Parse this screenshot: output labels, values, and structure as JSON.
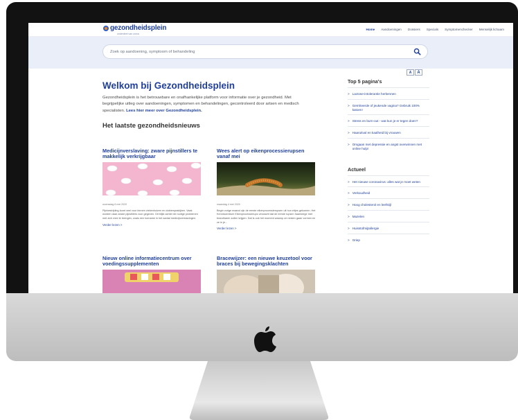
{
  "site": {
    "logo_name": "gezondheidsplein",
    "logo_tagline": "onderdeel van zorva",
    "nav": [
      {
        "label": "Home",
        "active": true
      },
      {
        "label": "Aandoeningen"
      },
      {
        "label": "Dossiers"
      },
      {
        "label": "Specials"
      },
      {
        "label": "Symptomenchecker"
      },
      {
        "label": "Menselijk lichaam"
      }
    ],
    "search": {
      "placeholder": "Zoek op aandoening, symptoom of behandeling"
    },
    "textsize": {
      "small": "A",
      "large": "A"
    }
  },
  "main": {
    "welcome_title": "Welkom bij Gezondheidsplein",
    "intro_text": "Gezondheidsplein is het betrouwbare en onafhankelijke platform voor informatie over je gezondheid. Met begrijpelijke uitleg over aandoeningen, symptomen en behandelingen, gecontroleerd door artsen en medisch specialisten.",
    "intro_link": "Lees hier meer over Gezondheidsplein.",
    "news_heading": "Het laatste gezondheidsnieuws",
    "articles": [
      {
        "title": "Medicijnverslaving: zware pijnstillers te makkelijk verkrijgbaar",
        "date": "woensdag 6 mei 2020",
        "body": "Pijnbestrijding komt veel voor binnen ziekenhuizen en doktersprakijken. Vaak worden daar zware pijnstillers voor gegeven. Dit blijkt achter de nodige problemen met zich mee te brengen, zoals een toename in het aantal medicijnverslavingen.",
        "more": "Verder lezen >"
      },
      {
        "title": "Wees alert op eikenprocessierupsen vanaf mei",
        "date": "maandag 4 mei 2020",
        "body": "Begin vorige maand zijn de eerste eikenprocessierupsen uit hun eitjes gekomen. Het Kenniscentrum Eikenprocessierups verwacht dat de eerste rupsen haarwrege met brandharen zullen krijgen. Dat is ook het moment waarop ze nesten gaan vormen en ze in je...",
        "more": "Verder lezen >"
      },
      {
        "title": "Nieuw online informatiecentrum over voedingssupplementen"
      },
      {
        "title": "Bracewijzer: een nieuwe keuzetool voor braces bij bewegingsklachten"
      }
    ]
  },
  "sidebar": {
    "top5_heading": "Top 5 pagina's",
    "top5": [
      "Lactose-intolerantie herkennen",
      "Geïrriteerde of jeukende vagina? Gebruik 100% katoen!",
      "Stress en burn-out - wat kun je er tegen doen?",
      "Haaruitval en kaalheid bij vrouwen",
      "Omgaan met depressie en angst overwinnen met online hulp!"
    ],
    "actueel_heading": "Actueel",
    "actueel": [
      "Het nieuwe coronavirus: alles wat je moet weten",
      "Verkoudheid",
      "Hoog cholesterol en leefstijl",
      "Mazelen",
      "Huisstofmijtallergie",
      "Griep"
    ],
    "arrow": ">"
  },
  "colors": {
    "brand_blue": "#1f3f9a",
    "search_band": "#eaeef8",
    "logo_orange": "#f08a1f",
    "bezel": "#121212"
  },
  "icons": [
    "search-icon",
    "apple-logo-icon",
    "chevron-right-icon"
  ]
}
